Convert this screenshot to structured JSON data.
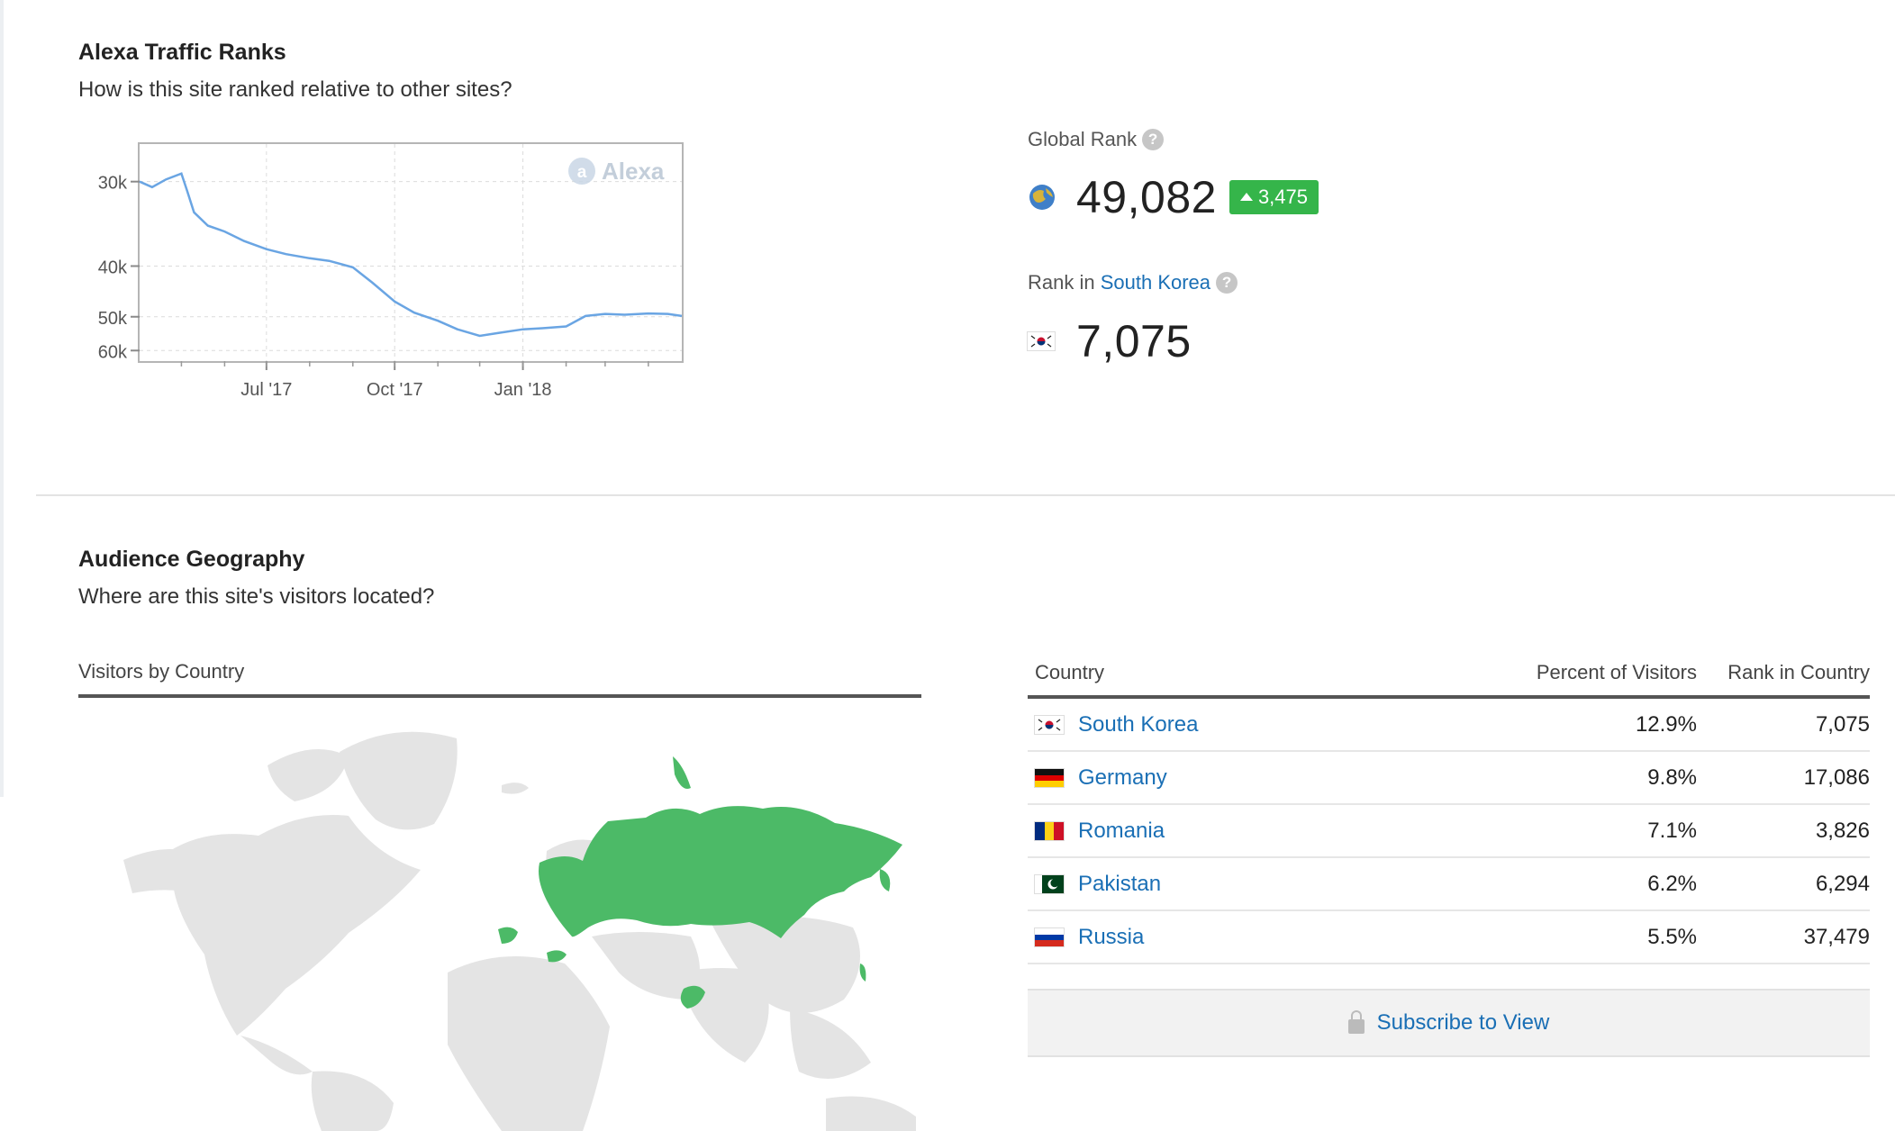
{
  "traffic": {
    "title": "Alexa Traffic Ranks",
    "subtitle": "How is this site ranked relative to other sites?",
    "watermark": "Alexa"
  },
  "chart_data": {
    "type": "line",
    "title": "",
    "xlabel": "",
    "ylabel": "",
    "y_inverted": true,
    "ylim": [
      27000,
      64000
    ],
    "y_ticks": [
      {
        "value": 30000,
        "label": "30k"
      },
      {
        "value": 40000,
        "label": "40k"
      },
      {
        "value": 50000,
        "label": "50k"
      },
      {
        "value": 60000,
        "label": "60k"
      }
    ],
    "x_ticks": [
      {
        "value": "2017-07-01",
        "label": "Jul '17"
      },
      {
        "value": "2017-10-01",
        "label": "Oct '17"
      },
      {
        "value": "2018-01-01",
        "label": "Jan '18"
      }
    ],
    "xlim": [
      "2017-04-01",
      "2018-04-25"
    ],
    "grid": true,
    "series_color": "#6aa5e3",
    "series": [
      {
        "x": [
          "2017-04-01",
          "2017-04-10",
          "2017-04-20",
          "2017-05-01",
          "2017-05-05",
          "2017-05-10",
          "2017-05-20",
          "2017-06-01",
          "2017-06-15",
          "2017-07-01",
          "2017-07-15",
          "2017-08-01",
          "2017-08-15",
          "2017-09-01",
          "2017-09-15",
          "2017-10-01",
          "2017-10-15",
          "2017-11-01",
          "2017-11-15",
          "2017-12-01",
          "2017-12-15",
          "2018-01-01",
          "2018-01-15",
          "2018-02-01",
          "2018-02-15",
          "2018-03-01",
          "2018-03-15",
          "2018-04-01",
          "2018-04-15",
          "2018-04-25"
        ],
        "y": [
          30000,
          30500,
          29800,
          29300,
          30800,
          33000,
          34500,
          35200,
          36400,
          37500,
          38200,
          38800,
          39200,
          40200,
          42800,
          46500,
          49000,
          51000,
          53300,
          55200,
          54300,
          53300,
          53000,
          52500,
          49800,
          49300,
          49500,
          49200,
          49300,
          49800
        ]
      }
    ]
  },
  "global_rank": {
    "label": "Global Rank",
    "value": "49,082",
    "delta": "3,475",
    "delta_direction": "up",
    "delta_color": "#35b54a",
    "icon": "globe-icon"
  },
  "country_rank": {
    "label_prefix": "Rank in",
    "country": "South Korea",
    "value": "7,075",
    "icon": "south-korea-flag-icon"
  },
  "geography": {
    "title": "Audience Geography",
    "subtitle": "Where are this site's visitors located?",
    "map_label": "Visitors by Country",
    "highlight_color": "#4cba67",
    "land_color": "#e4e4e4"
  },
  "table": {
    "headers": {
      "country": "Country",
      "percent": "Percent of Visitors",
      "rank": "Rank in Country"
    },
    "rows": [
      {
        "country": "South Korea",
        "percent": "12.9%",
        "rank": "7,075",
        "flag": "south-korea-flag"
      },
      {
        "country": "Germany",
        "percent": "9.8%",
        "rank": "17,086",
        "flag": "germany-flag"
      },
      {
        "country": "Romania",
        "percent": "7.1%",
        "rank": "3,826",
        "flag": "romania-flag"
      },
      {
        "country": "Pakistan",
        "percent": "6.2%",
        "rank": "6,294",
        "flag": "pakistan-flag"
      },
      {
        "country": "Russia",
        "percent": "5.5%",
        "rank": "37,479",
        "flag": "russia-flag"
      }
    ]
  },
  "subscribe": {
    "label": "Subscribe to View"
  }
}
